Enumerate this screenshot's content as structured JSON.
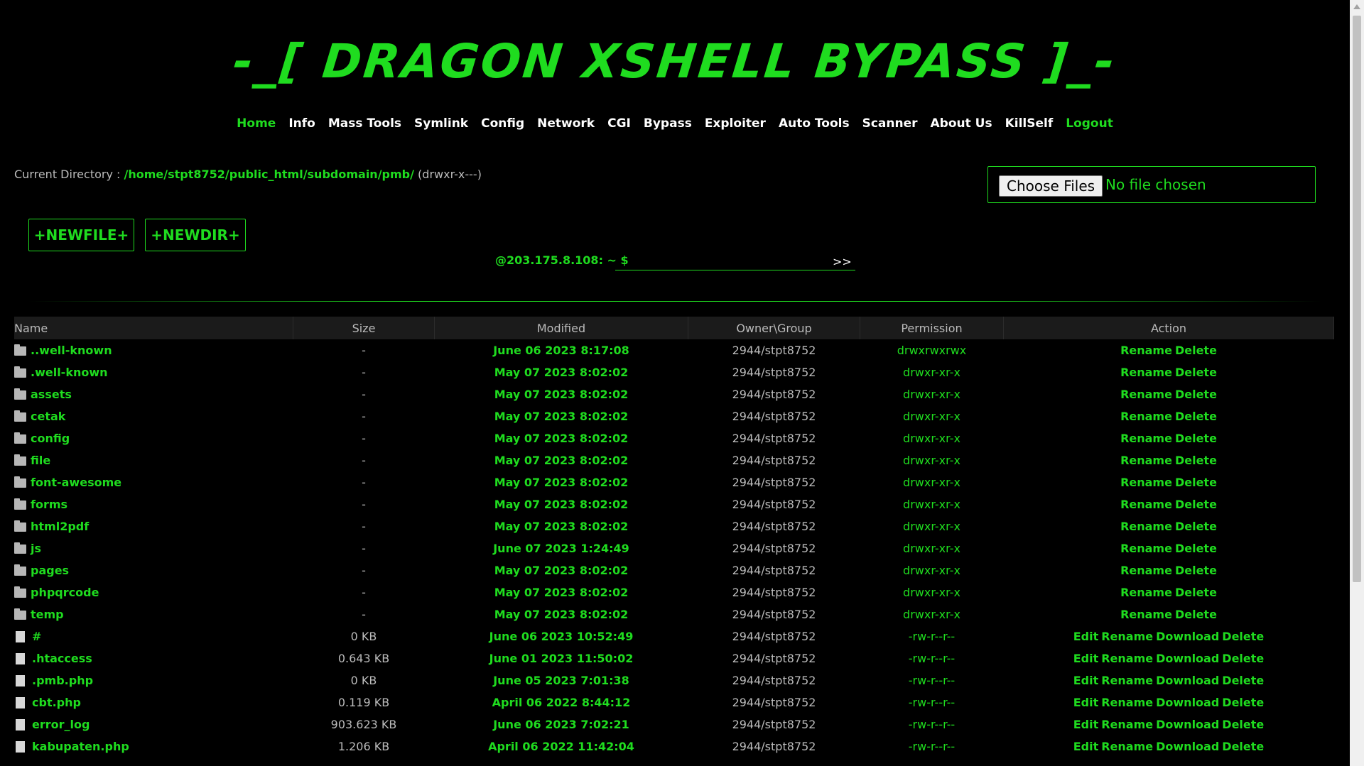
{
  "title": "-_[ DRAGON XSHELL BYPASS ]_-",
  "nav": [
    {
      "label": "Home",
      "highlight": true
    },
    {
      "label": "Info",
      "highlight": false
    },
    {
      "label": "Mass Tools",
      "highlight": false
    },
    {
      "label": "Symlink",
      "highlight": false
    },
    {
      "label": "Config",
      "highlight": false
    },
    {
      "label": "Network",
      "highlight": false
    },
    {
      "label": "CGI",
      "highlight": false
    },
    {
      "label": "Bypass",
      "highlight": false
    },
    {
      "label": "Exploiter",
      "highlight": false
    },
    {
      "label": "Auto Tools",
      "highlight": false
    },
    {
      "label": "Scanner",
      "highlight": false
    },
    {
      "label": "About Us",
      "highlight": false
    },
    {
      "label": "KillSelf",
      "highlight": false
    },
    {
      "label": "Logout",
      "highlight": true
    }
  ],
  "current_directory": {
    "label": "Current Directory :",
    "path": "/home/stpt8752/public_html/subdomain/pmb/",
    "perm": "(drwxr-x---)"
  },
  "upload": {
    "button_label": "Choose Files",
    "status": "No file chosen"
  },
  "buttons": {
    "new_file": "+NEWFILE+",
    "new_dir": "+NEWDIR+"
  },
  "command": {
    "prompt": "@203.175.8.108: ~ $",
    "value": "",
    "submit": ">>"
  },
  "table": {
    "headers": [
      "Name",
      "Size",
      "Modified",
      "Owner\\Group",
      "Permission",
      "Action"
    ],
    "rows": [
      {
        "type": "folder",
        "name": "..well-known",
        "size": "-",
        "modified": "June 06 2023 8:17:08",
        "owner": "2944/stpt8752",
        "perm": "drwxrwxrwx",
        "actions": [
          "Rename",
          "Delete"
        ]
      },
      {
        "type": "folder",
        "name": ".well-known",
        "size": "-",
        "modified": "May 07 2023 8:02:02",
        "owner": "2944/stpt8752",
        "perm": "drwxr-xr-x",
        "actions": [
          "Rename",
          "Delete"
        ]
      },
      {
        "type": "folder",
        "name": "assets",
        "size": "-",
        "modified": "May 07 2023 8:02:02",
        "owner": "2944/stpt8752",
        "perm": "drwxr-xr-x",
        "actions": [
          "Rename",
          "Delete"
        ]
      },
      {
        "type": "folder",
        "name": "cetak",
        "size": "-",
        "modified": "May 07 2023 8:02:02",
        "owner": "2944/stpt8752",
        "perm": "drwxr-xr-x",
        "actions": [
          "Rename",
          "Delete"
        ]
      },
      {
        "type": "folder",
        "name": "config",
        "size": "-",
        "modified": "May 07 2023 8:02:02",
        "owner": "2944/stpt8752",
        "perm": "drwxr-xr-x",
        "actions": [
          "Rename",
          "Delete"
        ]
      },
      {
        "type": "folder",
        "name": "file",
        "size": "-",
        "modified": "May 07 2023 8:02:02",
        "owner": "2944/stpt8752",
        "perm": "drwxr-xr-x",
        "actions": [
          "Rename",
          "Delete"
        ]
      },
      {
        "type": "folder",
        "name": "font-awesome",
        "size": "-",
        "modified": "May 07 2023 8:02:02",
        "owner": "2944/stpt8752",
        "perm": "drwxr-xr-x",
        "actions": [
          "Rename",
          "Delete"
        ]
      },
      {
        "type": "folder",
        "name": "forms",
        "size": "-",
        "modified": "May 07 2023 8:02:02",
        "owner": "2944/stpt8752",
        "perm": "drwxr-xr-x",
        "actions": [
          "Rename",
          "Delete"
        ]
      },
      {
        "type": "folder",
        "name": "html2pdf",
        "size": "-",
        "modified": "May 07 2023 8:02:02",
        "owner": "2944/stpt8752",
        "perm": "drwxr-xr-x",
        "actions": [
          "Rename",
          "Delete"
        ]
      },
      {
        "type": "folder",
        "name": "js",
        "size": "-",
        "modified": "June 07 2023 1:24:49",
        "owner": "2944/stpt8752",
        "perm": "drwxr-xr-x",
        "actions": [
          "Rename",
          "Delete"
        ]
      },
      {
        "type": "folder",
        "name": "pages",
        "size": "-",
        "modified": "May 07 2023 8:02:02",
        "owner": "2944/stpt8752",
        "perm": "drwxr-xr-x",
        "actions": [
          "Rename",
          "Delete"
        ]
      },
      {
        "type": "folder",
        "name": "phpqrcode",
        "size": "-",
        "modified": "May 07 2023 8:02:02",
        "owner": "2944/stpt8752",
        "perm": "drwxr-xr-x",
        "actions": [
          "Rename",
          "Delete"
        ]
      },
      {
        "type": "folder",
        "name": "temp",
        "size": "-",
        "modified": "May 07 2023 8:02:02",
        "owner": "2944/stpt8752",
        "perm": "drwxr-xr-x",
        "actions": [
          "Rename",
          "Delete"
        ]
      },
      {
        "type": "file",
        "name": "#",
        "size": "0 KB",
        "modified": "June 06 2023 10:52:49",
        "owner": "2944/stpt8752",
        "perm": "-rw-r--r--",
        "actions": [
          "Edit",
          "Rename",
          "Download",
          "Delete"
        ]
      },
      {
        "type": "file",
        "name": ".htaccess",
        "size": "0.643 KB",
        "modified": "June 01 2023 11:50:02",
        "owner": "2944/stpt8752",
        "perm": "-rw-r--r--",
        "actions": [
          "Edit",
          "Rename",
          "Download",
          "Delete"
        ]
      },
      {
        "type": "file",
        "name": ".pmb.php",
        "size": "0 KB",
        "modified": "June 05 2023 7:01:38",
        "owner": "2944/stpt8752",
        "perm": "-rw-r--r--",
        "actions": [
          "Edit",
          "Rename",
          "Download",
          "Delete"
        ]
      },
      {
        "type": "file",
        "name": "cbt.php",
        "size": "0.119 KB",
        "modified": "April 06 2022 8:44:12",
        "owner": "2944/stpt8752",
        "perm": "-rw-r--r--",
        "actions": [
          "Edit",
          "Rename",
          "Download",
          "Delete"
        ]
      },
      {
        "type": "file",
        "name": "error_log",
        "size": "903.623 KB",
        "modified": "June 06 2023 7:02:21",
        "owner": "2944/stpt8752",
        "perm": "-rw-r--r--",
        "actions": [
          "Edit",
          "Rename",
          "Download",
          "Delete"
        ]
      },
      {
        "type": "file",
        "name": "kabupaten.php",
        "size": "1.206 KB",
        "modified": "April 06 2022 11:42:04",
        "owner": "2944/stpt8752",
        "perm": "-rw-r--r--",
        "actions": [
          "Edit",
          "Rename",
          "Download",
          "Delete"
        ]
      }
    ]
  },
  "colors": {
    "accent": "#1fdc1f",
    "background": "#000000"
  }
}
